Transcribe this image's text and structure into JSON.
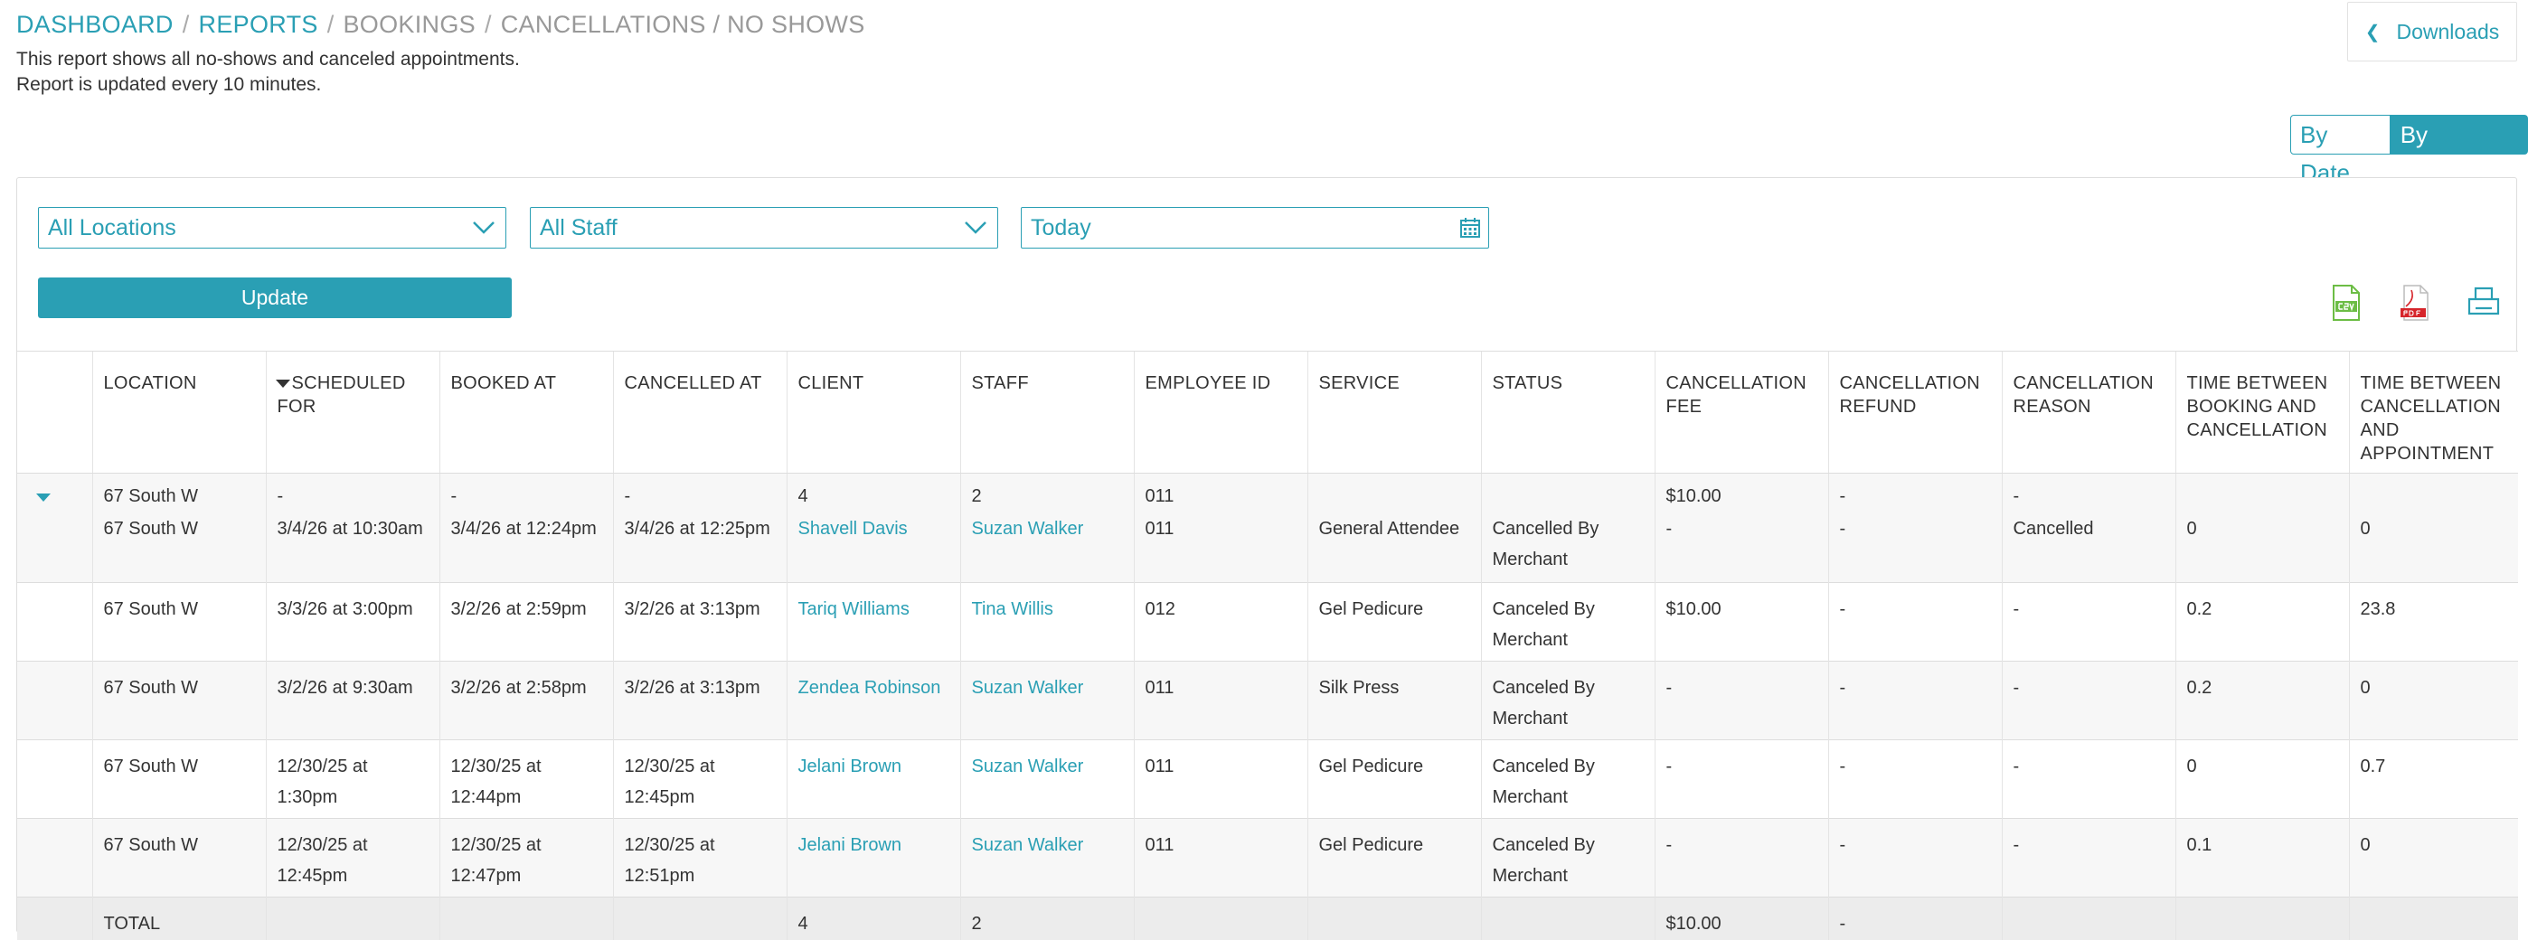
{
  "breadcrumb": {
    "items": [
      {
        "label": "DASHBOARD",
        "link": true
      },
      {
        "label": "REPORTS",
        "link": true
      },
      {
        "label": "BOOKINGS",
        "link": false
      },
      {
        "label": "CANCELLATIONS / NO SHOWS",
        "link": false
      }
    ]
  },
  "description": {
    "line1": "This report shows all no-shows and canceled appointments.",
    "line2": "Report is updated every 10 minutes."
  },
  "downloads": {
    "label": "Downloads"
  },
  "view_toggle": {
    "by_date": "By Date",
    "by_location": "By Location",
    "active": "by_location"
  },
  "filters": {
    "location": {
      "value": "All Locations"
    },
    "staff": {
      "value": "All Staff"
    },
    "date": {
      "value": "Today"
    }
  },
  "update_label": "Update",
  "export_icons": [
    "csv-icon",
    "pdf-icon",
    "print-icon"
  ],
  "table": {
    "headers": {
      "location": "LOCATION",
      "scheduled_for": [
        "SCHEDULED",
        "FOR"
      ],
      "booked_at": "BOOKED AT",
      "cancelled_at": "CANCELLED AT",
      "client": "CLIENT",
      "staff": "STAFF",
      "employee_id": "EMPLOYEE ID",
      "service": "SERVICE",
      "status": "STATUS",
      "cancellation_fee": [
        "CANCELLATION",
        "FEE"
      ],
      "cancellation_refund": [
        "CANCELLATION",
        "REFUND"
      ],
      "cancellation_reason": [
        "CANCELLATION",
        "REASON"
      ],
      "time_booking_cancel": [
        "TIME BETWEEN",
        "BOOKING AND",
        "CANCELLATION"
      ],
      "time_cancel_appt": [
        "TIME BETWEEN",
        "CANCELLATION",
        "AND",
        "APPOINTMENT"
      ]
    },
    "group": {
      "location": "67 South W",
      "scheduled_for": "-",
      "booked_at": "-",
      "cancelled_at": "-",
      "client": "4",
      "staff": "2",
      "employee_id": "011",
      "cancellation_fee": "$10.00",
      "cancellation_refund": "-",
      "cancellation_reason": "-"
    },
    "rows": [
      {
        "location": "67 South W",
        "scheduled_for": [
          "3/4/26 at 10:30am"
        ],
        "booked_at": [
          "3/4/26 at 12:24pm"
        ],
        "cancelled_at": [
          "3/4/26 at 12:25pm"
        ],
        "client": "Shavell Davis",
        "staff": "Suzan Walker",
        "employee_id": "011",
        "service": "General Attendee",
        "status": [
          "Cancelled By",
          "Merchant"
        ],
        "cancellation_fee": "-",
        "cancellation_refund": "-",
        "cancellation_reason": "Cancelled",
        "time_booking_cancel": "0",
        "time_cancel_appt": "0"
      },
      {
        "location": "67 South W",
        "scheduled_for": [
          "3/3/26 at 3:00pm"
        ],
        "booked_at": [
          "3/2/26 at 2:59pm"
        ],
        "cancelled_at": [
          "3/2/26 at 3:13pm"
        ],
        "client": "Tariq Williams",
        "staff": "Tina Willis",
        "employee_id": "012",
        "service": "Gel Pedicure",
        "status": [
          "Canceled By",
          "Merchant"
        ],
        "cancellation_fee": "$10.00",
        "cancellation_refund": "-",
        "cancellation_reason": "-",
        "time_booking_cancel": "0.2",
        "time_cancel_appt": "23.8"
      },
      {
        "location": "67 South W",
        "scheduled_for": [
          "3/2/26 at 9:30am"
        ],
        "booked_at": [
          "3/2/26 at 2:58pm"
        ],
        "cancelled_at": [
          "3/2/26 at 3:13pm"
        ],
        "client": "Zendea Robinson",
        "staff": "Suzan Walker",
        "employee_id": "011",
        "service": "Silk Press",
        "status": [
          "Canceled By",
          "Merchant"
        ],
        "cancellation_fee": "-",
        "cancellation_refund": "-",
        "cancellation_reason": "-",
        "time_booking_cancel": "0.2",
        "time_cancel_appt": "0"
      },
      {
        "location": "67 South W",
        "scheduled_for": [
          "12/30/25 at",
          "1:30pm"
        ],
        "booked_at": [
          "12/30/25 at",
          "12:44pm"
        ],
        "cancelled_at": [
          "12/30/25 at",
          "12:45pm"
        ],
        "client": "Jelani Brown",
        "staff": "Suzan Walker",
        "employee_id": "011",
        "service": "Gel Pedicure",
        "status": [
          "Canceled By",
          "Merchant"
        ],
        "cancellation_fee": "-",
        "cancellation_refund": "-",
        "cancellation_reason": "-",
        "time_booking_cancel": "0",
        "time_cancel_appt": "0.7"
      },
      {
        "location": "67 South W",
        "scheduled_for": [
          "12/30/25 at",
          "12:45pm"
        ],
        "booked_at": [
          "12/30/25 at",
          "12:47pm"
        ],
        "cancelled_at": [
          "12/30/25 at",
          "12:51pm"
        ],
        "client": "Jelani Brown",
        "staff": "Suzan Walker",
        "employee_id": "011",
        "service": "Gel Pedicure",
        "status": [
          "Canceled By",
          "Merchant"
        ],
        "cancellation_fee": "-",
        "cancellation_refund": "-",
        "cancellation_reason": "-",
        "time_booking_cancel": "0.1",
        "time_cancel_appt": "0"
      }
    ],
    "total": {
      "label": "TOTAL",
      "client": "4",
      "staff": "2",
      "cancellation_fee": "$10.00",
      "cancellation_refund": "-"
    }
  },
  "colors": {
    "accent": "#2a9fb4",
    "row_alt": "#f7f7f7",
    "total_bg": "#ececec"
  }
}
